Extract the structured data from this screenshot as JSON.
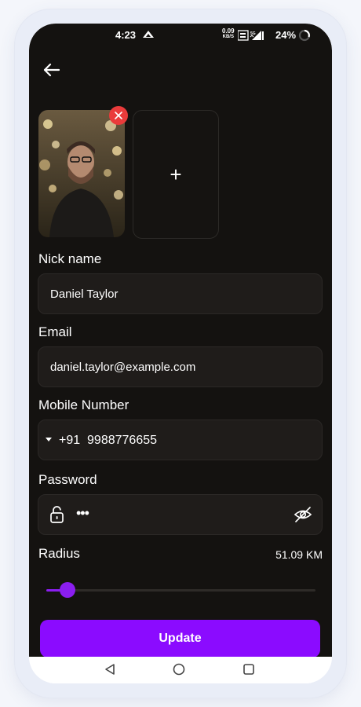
{
  "status_bar": {
    "time": "4:23",
    "net_speed_value": "0.09",
    "net_speed_unit": "KB/S",
    "battery": "24%",
    "icons": [
      "upload-arrow-icon",
      "volte-icon",
      "5g-signal-icon",
      "battery-ring-icon"
    ]
  },
  "header": {
    "back_icon": "arrow-left-icon"
  },
  "photos": {
    "remove_icon": "close-icon",
    "add_label": "+"
  },
  "form": {
    "nick_label": "Nick name",
    "nick_value": "Daniel Taylor",
    "email_label": "Email",
    "email_value": "daniel.taylor@example.com",
    "mobile_label": "Mobile Number",
    "mobile_value": "+91  9988776655",
    "password_label": "Password",
    "password_value": "•••",
    "password_icons": [
      "lock-icon",
      "eye-off-icon"
    ],
    "radius_label": "Radius",
    "radius_value": "51.09 KM",
    "radius_fraction": 0.08
  },
  "update_button": "Update",
  "nav_bar": [
    "back-triangle-icon",
    "home-circle-icon",
    "recents-square-icon"
  ],
  "colors": {
    "accent": "#8b0bff",
    "background": "#141210",
    "field": "#1f1c1a",
    "remove": "#ea3b3b"
  }
}
